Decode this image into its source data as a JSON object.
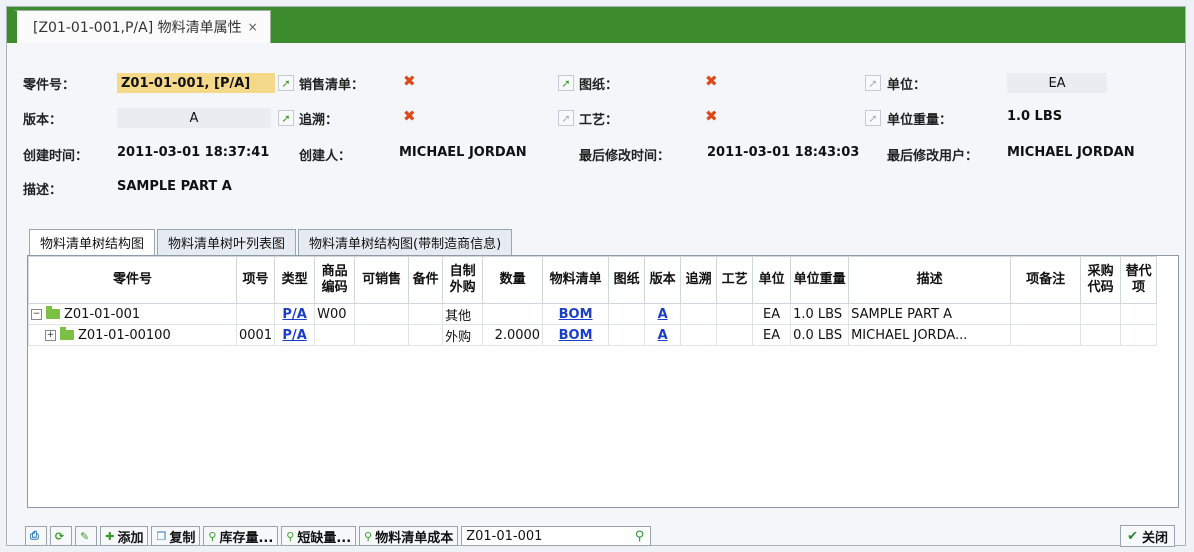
{
  "window": {
    "tab_title": "[Z01-01-001,P/A] 物料清单属性",
    "close": "×"
  },
  "colors": {
    "accent": "#3c8c2e",
    "highlight": "#f4d98a",
    "x_mark": "#e04818",
    "link": "#1a3ec8"
  },
  "fields": {
    "part_no_label": "零件号：",
    "part_no": "Z01-01-001, [P/A]",
    "sales_bom_label": "销售清单：",
    "sales_bom": "✖",
    "drawing_label": "图纸：",
    "drawing": "✖",
    "unit_label": "单位：",
    "unit": "EA",
    "version_label": "版本：",
    "version": "A",
    "trace_label": "追溯：",
    "trace": "✖",
    "process_label": "工艺：",
    "process": "✖",
    "unit_weight_label": "单位重量：",
    "unit_weight": "1.0 LBS",
    "created_label": "创建时间：",
    "created": "2011-03-01 18:37:41",
    "creator_label": "创建人：",
    "creator": "MICHAEL JORDAN",
    "modified_label": "最后修改时间：",
    "modified": "2011-03-01 18:43:03",
    "modifier_label": "最后修改用户：",
    "modifier": "MICHAEL JORDAN",
    "desc_label": "描述：",
    "desc": "SAMPLE PART A"
  },
  "subtabs": [
    "物料清单树结构图",
    "物料清单树叶列表图",
    "物料清单树结构图(带制造商信息)"
  ],
  "grid": {
    "headers": [
      "零件号",
      "项号",
      "类型",
      "商品编码",
      "可销售",
      "备件",
      "自制外购",
      "数量",
      "物料清单",
      "图纸",
      "版本",
      "追溯",
      "工艺",
      "单位",
      "单位重量",
      "描述",
      "项备注",
      "采购代码",
      "替代项"
    ],
    "rows": [
      {
        "part": "Z01-01-001",
        "item": "",
        "type": "P/A",
        "code": "W00",
        "sellable": "",
        "spare": "",
        "make_buy": "其他",
        "qty": "",
        "bom": "BOM",
        "drawing": "",
        "version": "A",
        "trace": "",
        "process": "",
        "unit": "EA",
        "weight": "1.0 LBS",
        "desc": "SAMPLE PART A",
        "note": "",
        "purchase": "",
        "alt": ""
      },
      {
        "part": "Z01-01-00100",
        "item": "0001",
        "type": "P/A",
        "code": "",
        "sellable": "",
        "spare": "",
        "make_buy": "外购",
        "qty": "2.0000",
        "bom": "BOM",
        "drawing": "",
        "version": "A",
        "trace": "",
        "process": "",
        "unit": "EA",
        "weight": "0.0 LBS",
        "desc": "MICHAEL JORDA...",
        "note": "",
        "purchase": "",
        "alt": ""
      }
    ]
  },
  "toolbar": {
    "add": "添加",
    "copy": "复制",
    "stock": "库存量...",
    "shortage": "短缺量...",
    "bom_cost": "物料清单成本",
    "search_value": "Z01-01-001",
    "close": "关闭"
  }
}
